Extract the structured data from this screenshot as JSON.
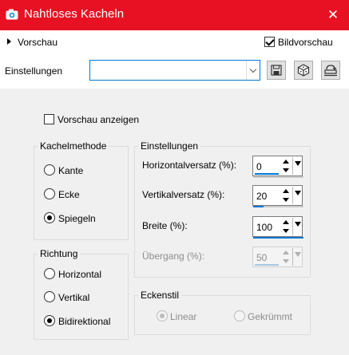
{
  "window": {
    "title": "Nahtloses Kacheln",
    "close_glyph": "✕"
  },
  "header": {
    "preview_toggle": "Vorschau",
    "bild_preview": {
      "label": "Bildvorschau",
      "checked": true
    },
    "settings_label": "Einstellungen",
    "preset_value": ""
  },
  "options": {
    "preview_checkbox": {
      "label": "Vorschau anzeigen",
      "checked": false
    }
  },
  "tiling_method": {
    "title": "Kachelmethode",
    "items": [
      {
        "label": "Kante",
        "checked": false
      },
      {
        "label": "Ecke",
        "checked": false
      },
      {
        "label": "Spiegeln",
        "checked": true
      }
    ]
  },
  "direction": {
    "title": "Richtung",
    "items": [
      {
        "label": "Horizontal",
        "checked": false
      },
      {
        "label": "Vertikal",
        "checked": false
      },
      {
        "label": "Bidirektional",
        "checked": true
      }
    ]
  },
  "settings": {
    "title": "Einstellungen",
    "fields": [
      {
        "label": "Horizontalversatz (%):",
        "value": "0",
        "enabled": true,
        "level": 0.0
      },
      {
        "label": "Vertikalversatz (%):",
        "value": "20",
        "enabled": true,
        "level": 0.2
      },
      {
        "label": "Breite (%):",
        "value": "100",
        "enabled": true,
        "level": 1.0
      },
      {
        "label": "Übergang (%):",
        "value": "50",
        "enabled": false,
        "level": 0.5
      }
    ]
  },
  "corner_style": {
    "title": "Eckenstil",
    "items": [
      {
        "label": "Linear",
        "checked": true,
        "enabled": false
      },
      {
        "label": "Gekrümmt",
        "checked": false,
        "enabled": false
      }
    ]
  },
  "colors": {
    "titlebar": "#e81123",
    "accent": "#0078d7"
  },
  "icons": [
    "camera-icon",
    "close-icon",
    "save-icon",
    "randomize-icon",
    "reset-icon"
  ]
}
